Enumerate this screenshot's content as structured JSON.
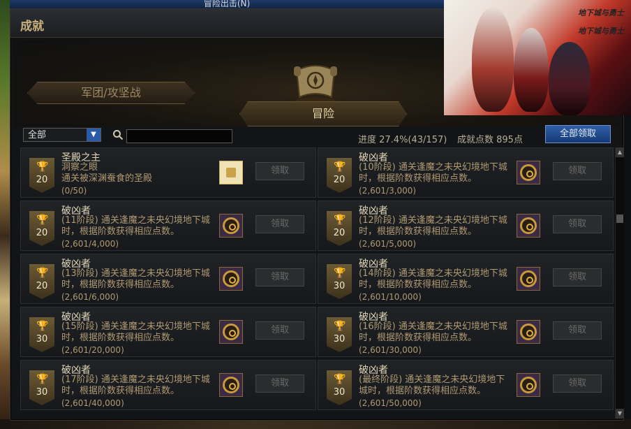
{
  "window": {
    "top_title": "冒险出击(N)"
  },
  "panel": {
    "title": "成就"
  },
  "banner": {
    "logo_text": "地下城与勇士"
  },
  "tabs": [
    {
      "label": "军团/攻坚战",
      "active": false
    },
    {
      "label": "冒险",
      "active": true
    }
  ],
  "filter": {
    "selected": "全部",
    "search_placeholder": ""
  },
  "summary": {
    "progress": "进度 27.4%(43/157)",
    "points": "成就点数 895点",
    "claim_all": "全部领取"
  },
  "achievements": [
    {
      "name": "圣殿之主",
      "desc": "洞察之眼\n通关被深渊蚕食的圣殿",
      "progress": "(0/50)",
      "points": "20",
      "reward": "box-icon",
      "claim": "领取"
    },
    {
      "name": "破凶者",
      "desc": "(10阶段) 通关逢魔之未央幻境地下城时，根据阶数获得相应点数。",
      "progress": "(2,601/3,000)",
      "points": "20",
      "reward": "emblem-icon",
      "claim": "领取"
    },
    {
      "name": "破凶者",
      "desc": "(11阶段) 通关逢魔之未央幻境地下城时，根据阶数获得相应点数。",
      "progress": "(2,601/4,000)",
      "points": "20",
      "reward": "emblem-icon",
      "claim": "领取"
    },
    {
      "name": "破凶者",
      "desc": "(12阶段) 通关逢魔之未央幻境地下城时，根据阶数获得相应点数。",
      "progress": "(2,601/5,000)",
      "points": "20",
      "reward": "emblem-icon",
      "claim": "领取"
    },
    {
      "name": "破凶者",
      "desc": "(13阶段) 通关逢魔之未央幻境地下城时，根据阶数获得相应点数。",
      "progress": "(2,601/6,000)",
      "points": "20",
      "reward": "emblem-icon",
      "claim": "领取"
    },
    {
      "name": "破凶者",
      "desc": "(14阶段) 通关逢魔之未央幻境地下城时，根据阶数获得相应点数。",
      "progress": "(2,601/10,000)",
      "points": "30",
      "reward": "emblem-icon",
      "claim": "领取"
    },
    {
      "name": "破凶者",
      "desc": "(15阶段) 通关逢魔之未央幻境地下城时，根据阶数获得相应点数。",
      "progress": "(2,601/20,000)",
      "points": "30",
      "reward": "emblem-icon",
      "claim": "领取"
    },
    {
      "name": "破凶者",
      "desc": "(16阶段) 通关逢魔之未央幻境地下城时，根据阶数获得相应点数。",
      "progress": "(2,601/30,000)",
      "points": "30",
      "reward": "emblem-icon",
      "claim": "领取"
    },
    {
      "name": "破凶者",
      "desc": "(17阶段) 通关逢魔之未央幻境地下城时，根据阶数获得相应点数。",
      "progress": "(2,601/40,000)",
      "points": "30",
      "reward": "emblem-icon",
      "claim": "领取"
    },
    {
      "name": "破凶者",
      "desc": "(最终阶段) 通关逢魔之未央幻境地下城时，根据阶数获得相应点数。",
      "progress": "(2,601/50,000)",
      "points": "30",
      "reward": "emblem-icon",
      "claim": "领取"
    }
  ]
}
